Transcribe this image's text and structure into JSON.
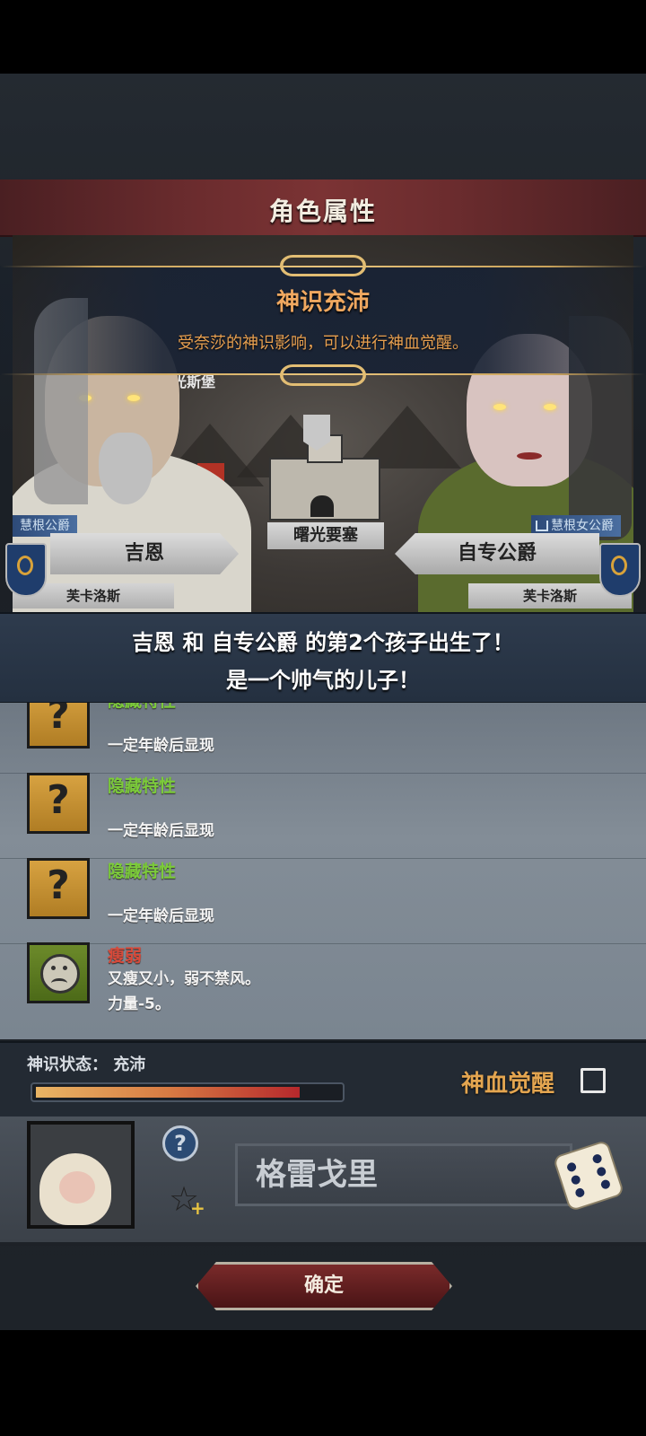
{
  "header": {
    "title": "角色属性"
  },
  "banner": {
    "title": "神识充沛",
    "subtitle": "受奈莎的神识影响，可以进行神血觉醒。"
  },
  "scene": {
    "map_label_top": "光斯堡",
    "fortress_label": "曙光要塞"
  },
  "father": {
    "title": "慧根公爵",
    "name": "吉恩",
    "house": "芙卡洛斯"
  },
  "mother": {
    "title": "慧根女公爵",
    "name": "自专公爵",
    "house": "芙卡洛斯"
  },
  "announcement": {
    "line1": "吉恩 和 自专公爵 的第2个孩子出生了！",
    "line2": "是一个帅气的儿子！"
  },
  "traits": [
    {
      "name": "隐藏特性",
      "desc": "一定年龄后显现",
      "icon": "question-icon",
      "kind": "hidden"
    },
    {
      "name": "隐藏特性",
      "desc": "一定年龄后显现",
      "icon": "question-icon",
      "kind": "hidden"
    },
    {
      "name": "隐藏特性",
      "desc": "一定年龄后显现",
      "icon": "question-icon",
      "kind": "hidden"
    },
    {
      "name": "瘦弱",
      "desc": "又瘦又小，弱不禁风。",
      "effect": "力量-5。",
      "icon": "sad-face-icon",
      "kind": "negative"
    }
  ],
  "status": {
    "label": "神识状态： 充沛",
    "progress": 0.88,
    "awaken_label": "神血觉醒",
    "awaken_checked": false
  },
  "child": {
    "name": "格雷戈里",
    "help_icon": "question-circle-icon",
    "favorite_icon": "star-plus-icon",
    "reroll_icon": "dice-icon"
  },
  "confirm_label": "确定",
  "colors": {
    "header": "#6b2c2e",
    "banner_text": "#f0a860",
    "trait_hidden": "#7ccb3a",
    "trait_negative": "#d84a3a",
    "awaken": "#e3a550"
  }
}
